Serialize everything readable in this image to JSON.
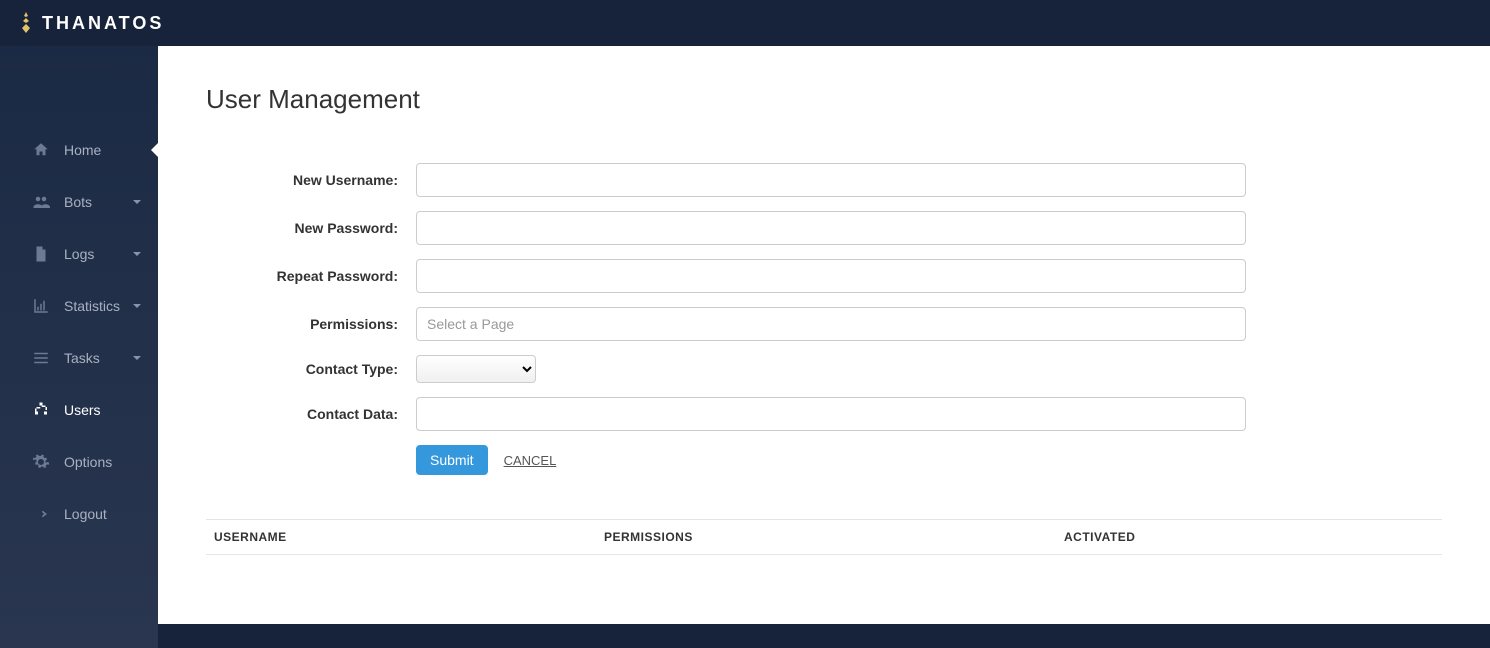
{
  "brand": {
    "name": "THANATOS"
  },
  "sidebar": {
    "items": [
      {
        "label": "Home"
      },
      {
        "label": "Bots"
      },
      {
        "label": "Logs"
      },
      {
        "label": "Statistics"
      },
      {
        "label": "Tasks"
      },
      {
        "label": "Users"
      },
      {
        "label": "Options"
      },
      {
        "label": "Logout"
      }
    ]
  },
  "page": {
    "title": "User Management"
  },
  "form": {
    "labels": {
      "new_username": "New Username:",
      "new_password": "New Password:",
      "repeat_password": "Repeat Password:",
      "permissions": "Permissions:",
      "contact_type": "Contact Type:",
      "contact_data": "Contact Data:"
    },
    "permissions_placeholder": "Select a Page",
    "submit": "Submit",
    "cancel": "CANCEL"
  },
  "table": {
    "headers": {
      "username": "USERNAME",
      "permissions": "PERMISSIONS",
      "activated": "ACTIVATED"
    }
  }
}
